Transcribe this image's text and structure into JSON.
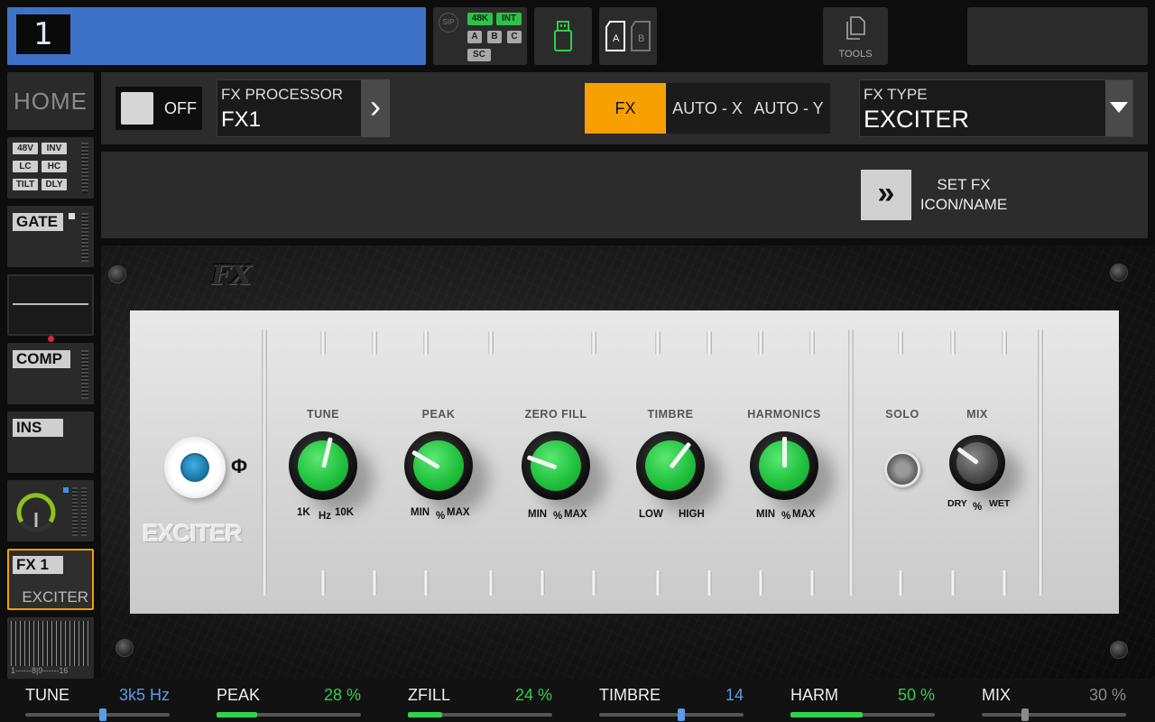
{
  "topbar": {
    "channel_number": "1",
    "sip_label": "SIP",
    "sample_rate": "48K",
    "clock": "INT",
    "slots": [
      "A",
      "B",
      "C"
    ],
    "sc_label": "SC",
    "card_a": "A",
    "card_b": "B",
    "tools_label": "TOOLS"
  },
  "sidebar": {
    "home_label": "HOME",
    "input_tags": [
      "48V",
      "INV",
      "LC",
      "HC",
      "TILT",
      "DLY"
    ],
    "gate_label": "GATE",
    "comp_label": "COMP",
    "ins_label": "INS",
    "fx_slot_label": "FX 1",
    "fx_slot_type": "EXCITER",
    "meter_scale": "1------8|9------16"
  },
  "header": {
    "power_label": "OFF",
    "processor_caption": "FX PROCESSOR",
    "processor_value": "FX1",
    "modes": [
      "FX",
      "AUTO - X",
      "AUTO - Y"
    ],
    "active_mode": "FX",
    "type_caption": "FX TYPE",
    "type_value": "EXCITER",
    "set_fx_line1": "SET FX",
    "set_fx_line2": "ICON/NAME"
  },
  "rack": {
    "logo": "FX",
    "unit_name": "EXCITER",
    "phase_symbol": "Φ",
    "knobs": [
      {
        "label": "TUNE",
        "scale_left": "1K",
        "scale_mid": "Hz",
        "scale_right": "10K",
        "value_fraction": 0.55
      },
      {
        "label": "PEAK",
        "scale_left": "MIN",
        "scale_mid": "%",
        "scale_right": "MAX",
        "value_fraction": 0.28
      },
      {
        "label": "ZERO FILL",
        "scale_left": "MIN",
        "scale_mid": "%",
        "scale_right": "MAX",
        "value_fraction": 0.24
      },
      {
        "label": "TIMBRE",
        "scale_left": "LOW",
        "scale_mid": "",
        "scale_right": "HIGH",
        "value_fraction": 0.64
      },
      {
        "label": "HARMONICS",
        "scale_left": "MIN",
        "scale_mid": "%",
        "scale_right": "MAX",
        "value_fraction": 0.5
      }
    ],
    "solo_label": "SOLO",
    "mix_knob": {
      "label": "MIX",
      "scale_left": "DRY",
      "scale_mid": "%",
      "scale_right": "WET",
      "value_fraction": 0.3
    }
  },
  "params": [
    {
      "name": "TUNE",
      "value": "3k5 Hz",
      "color": "#5b9be8",
      "kind": "thumb",
      "fraction": 0.54
    },
    {
      "name": "PEAK",
      "value": "28 %",
      "color": "#2fd24a",
      "kind": "fill",
      "fraction": 0.28
    },
    {
      "name": "ZFILL",
      "value": "24 %",
      "color": "#2fd24a",
      "kind": "fill",
      "fraction": 0.24
    },
    {
      "name": "TIMBRE",
      "value": "14",
      "color": "#5b9be8",
      "kind": "thumb",
      "fraction": 0.57
    },
    {
      "name": "HARM",
      "value": "50 %",
      "color": "#2fd24a",
      "kind": "fill",
      "fraction": 0.5
    },
    {
      "name": "MIX",
      "value": "30 %",
      "color": "#8a8a8a",
      "kind": "thumb",
      "fraction": 0.3
    }
  ],
  "colors": {
    "accent_blue": "#3d72c8",
    "accent_orange": "#f7a000",
    "knob_green": "#22c23f",
    "selected_outline": "#f0a000"
  }
}
